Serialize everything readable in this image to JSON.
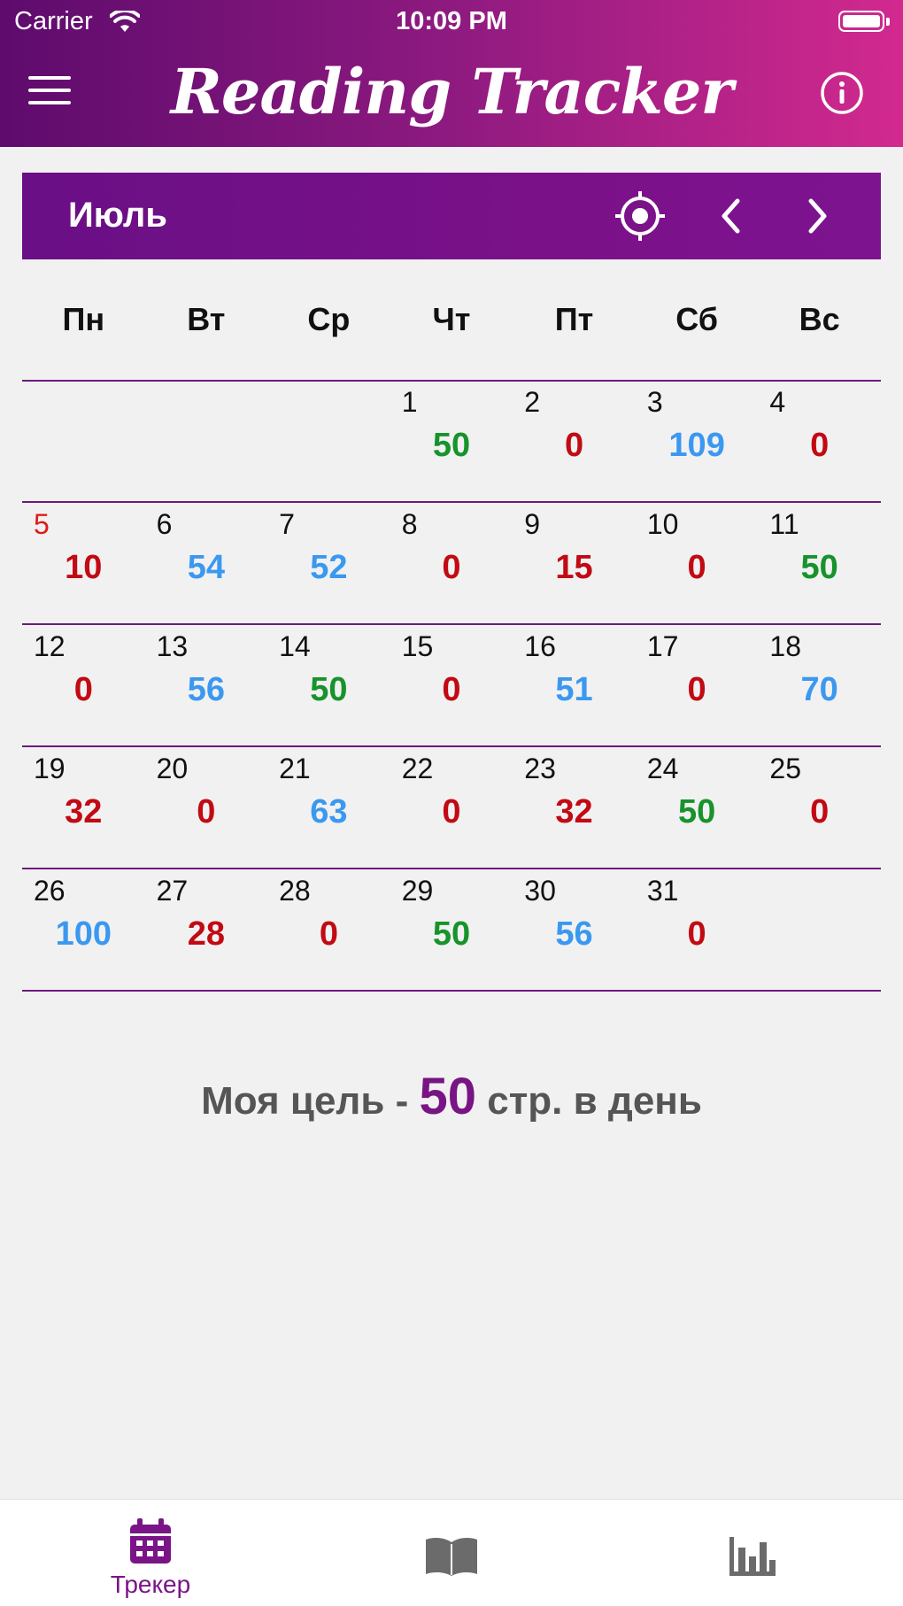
{
  "status_bar": {
    "carrier": "Carrier",
    "time": "10:09 PM"
  },
  "header": {
    "title": "Reading Tracker",
    "menu_icon": "hamburger-icon",
    "info_icon": "info-icon"
  },
  "month_bar": {
    "month": "Июль",
    "icons": [
      "target-icon",
      "chevron-left-icon",
      "chevron-right-icon"
    ]
  },
  "weekdays": [
    "Пн",
    "Вт",
    "Ср",
    "Чт",
    "Пт",
    "Сб",
    "Вс"
  ],
  "weeks": [
    [
      null,
      null,
      null,
      {
        "day": "1",
        "pages": "50",
        "status": "green"
      },
      {
        "day": "2",
        "pages": "0",
        "status": "red"
      },
      {
        "day": "3",
        "pages": "109",
        "status": "blue"
      },
      {
        "day": "4",
        "pages": "0",
        "status": "red"
      }
    ],
    [
      {
        "day": "5",
        "pages": "10",
        "status": "red",
        "day_color": "red"
      },
      {
        "day": "6",
        "pages": "54",
        "status": "blue"
      },
      {
        "day": "7",
        "pages": "52",
        "status": "blue"
      },
      {
        "day": "8",
        "pages": "0",
        "status": "red"
      },
      {
        "day": "9",
        "pages": "15",
        "status": "red"
      },
      {
        "day": "10",
        "pages": "0",
        "status": "red"
      },
      {
        "day": "11",
        "pages": "50",
        "status": "green"
      }
    ],
    [
      {
        "day": "12",
        "pages": "0",
        "status": "red"
      },
      {
        "day": "13",
        "pages": "56",
        "status": "blue"
      },
      {
        "day": "14",
        "pages": "50",
        "status": "green"
      },
      {
        "day": "15",
        "pages": "0",
        "status": "red"
      },
      {
        "day": "16",
        "pages": "51",
        "status": "blue"
      },
      {
        "day": "17",
        "pages": "0",
        "status": "red"
      },
      {
        "day": "18",
        "pages": "70",
        "status": "blue"
      }
    ],
    [
      {
        "day": "19",
        "pages": "32",
        "status": "red"
      },
      {
        "day": "20",
        "pages": "0",
        "status": "red"
      },
      {
        "day": "21",
        "pages": "63",
        "status": "blue"
      },
      {
        "day": "22",
        "pages": "0",
        "status": "red"
      },
      {
        "day": "23",
        "pages": "32",
        "status": "red"
      },
      {
        "day": "24",
        "pages": "50",
        "status": "green"
      },
      {
        "day": "25",
        "pages": "0",
        "status": "red"
      }
    ],
    [
      {
        "day": "26",
        "pages": "100",
        "status": "blue"
      },
      {
        "day": "27",
        "pages": "28",
        "status": "red"
      },
      {
        "day": "28",
        "pages": "0",
        "status": "red"
      },
      {
        "day": "29",
        "pages": "50",
        "status": "green"
      },
      {
        "day": "30",
        "pages": "56",
        "status": "blue"
      },
      {
        "day": "31",
        "pages": "0",
        "status": "red"
      },
      null
    ]
  ],
  "goal": {
    "prefix": "Моя цель - ",
    "value": "50",
    "suffix": " стр. в день"
  },
  "tabbar": {
    "tracker_label": "Трекер",
    "tracker_icon": "calendar-icon",
    "books_icon": "book-icon",
    "stats_icon": "bar-chart-icon"
  },
  "colors": {
    "accent": "#781484",
    "green": "#17932c",
    "red": "#c20a14",
    "blue": "#3b98f0",
    "tab_inactive": "#6b6b6b"
  }
}
